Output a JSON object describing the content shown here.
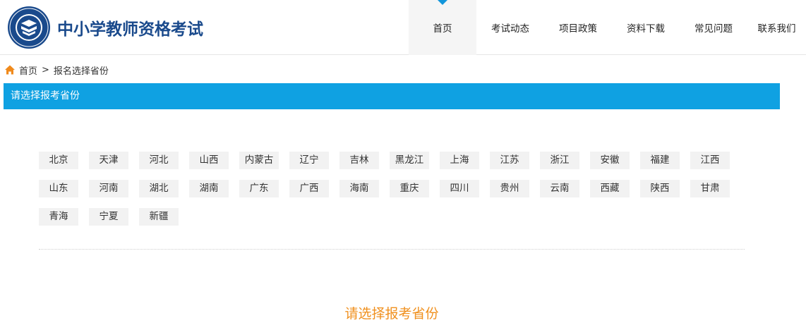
{
  "header": {
    "site_title": "中小学教师资格考试",
    "nav": [
      {
        "label": "首页",
        "active": true
      },
      {
        "label": "考试动态",
        "active": false
      },
      {
        "label": "项目政策",
        "active": false
      },
      {
        "label": "资料下载",
        "active": false
      },
      {
        "label": "常见问题",
        "active": false
      },
      {
        "label": "联系我们",
        "active": false
      }
    ]
  },
  "breadcrumb": {
    "home": "首页",
    "separator": ">",
    "current": "报名选择省份"
  },
  "section": {
    "title": "请选择报考省份"
  },
  "provinces": [
    "北京",
    "天津",
    "河北",
    "山西",
    "内蒙古",
    "辽宁",
    "吉林",
    "黑龙江",
    "上海",
    "江苏",
    "浙江",
    "安徽",
    "福建",
    "江西",
    "山东",
    "河南",
    "湖北",
    "湖南",
    "广东",
    "广西",
    "海南",
    "重庆",
    "四川",
    "贵州",
    "云南",
    "西藏",
    "陕西",
    "甘肃",
    "青海",
    "宁夏",
    "新疆"
  ],
  "prompt": "请选择报考省份",
  "colors": {
    "accent_blue": "#0fa1e2",
    "title_blue": "#1a4a8c",
    "prompt_orange": "#f0901e"
  }
}
